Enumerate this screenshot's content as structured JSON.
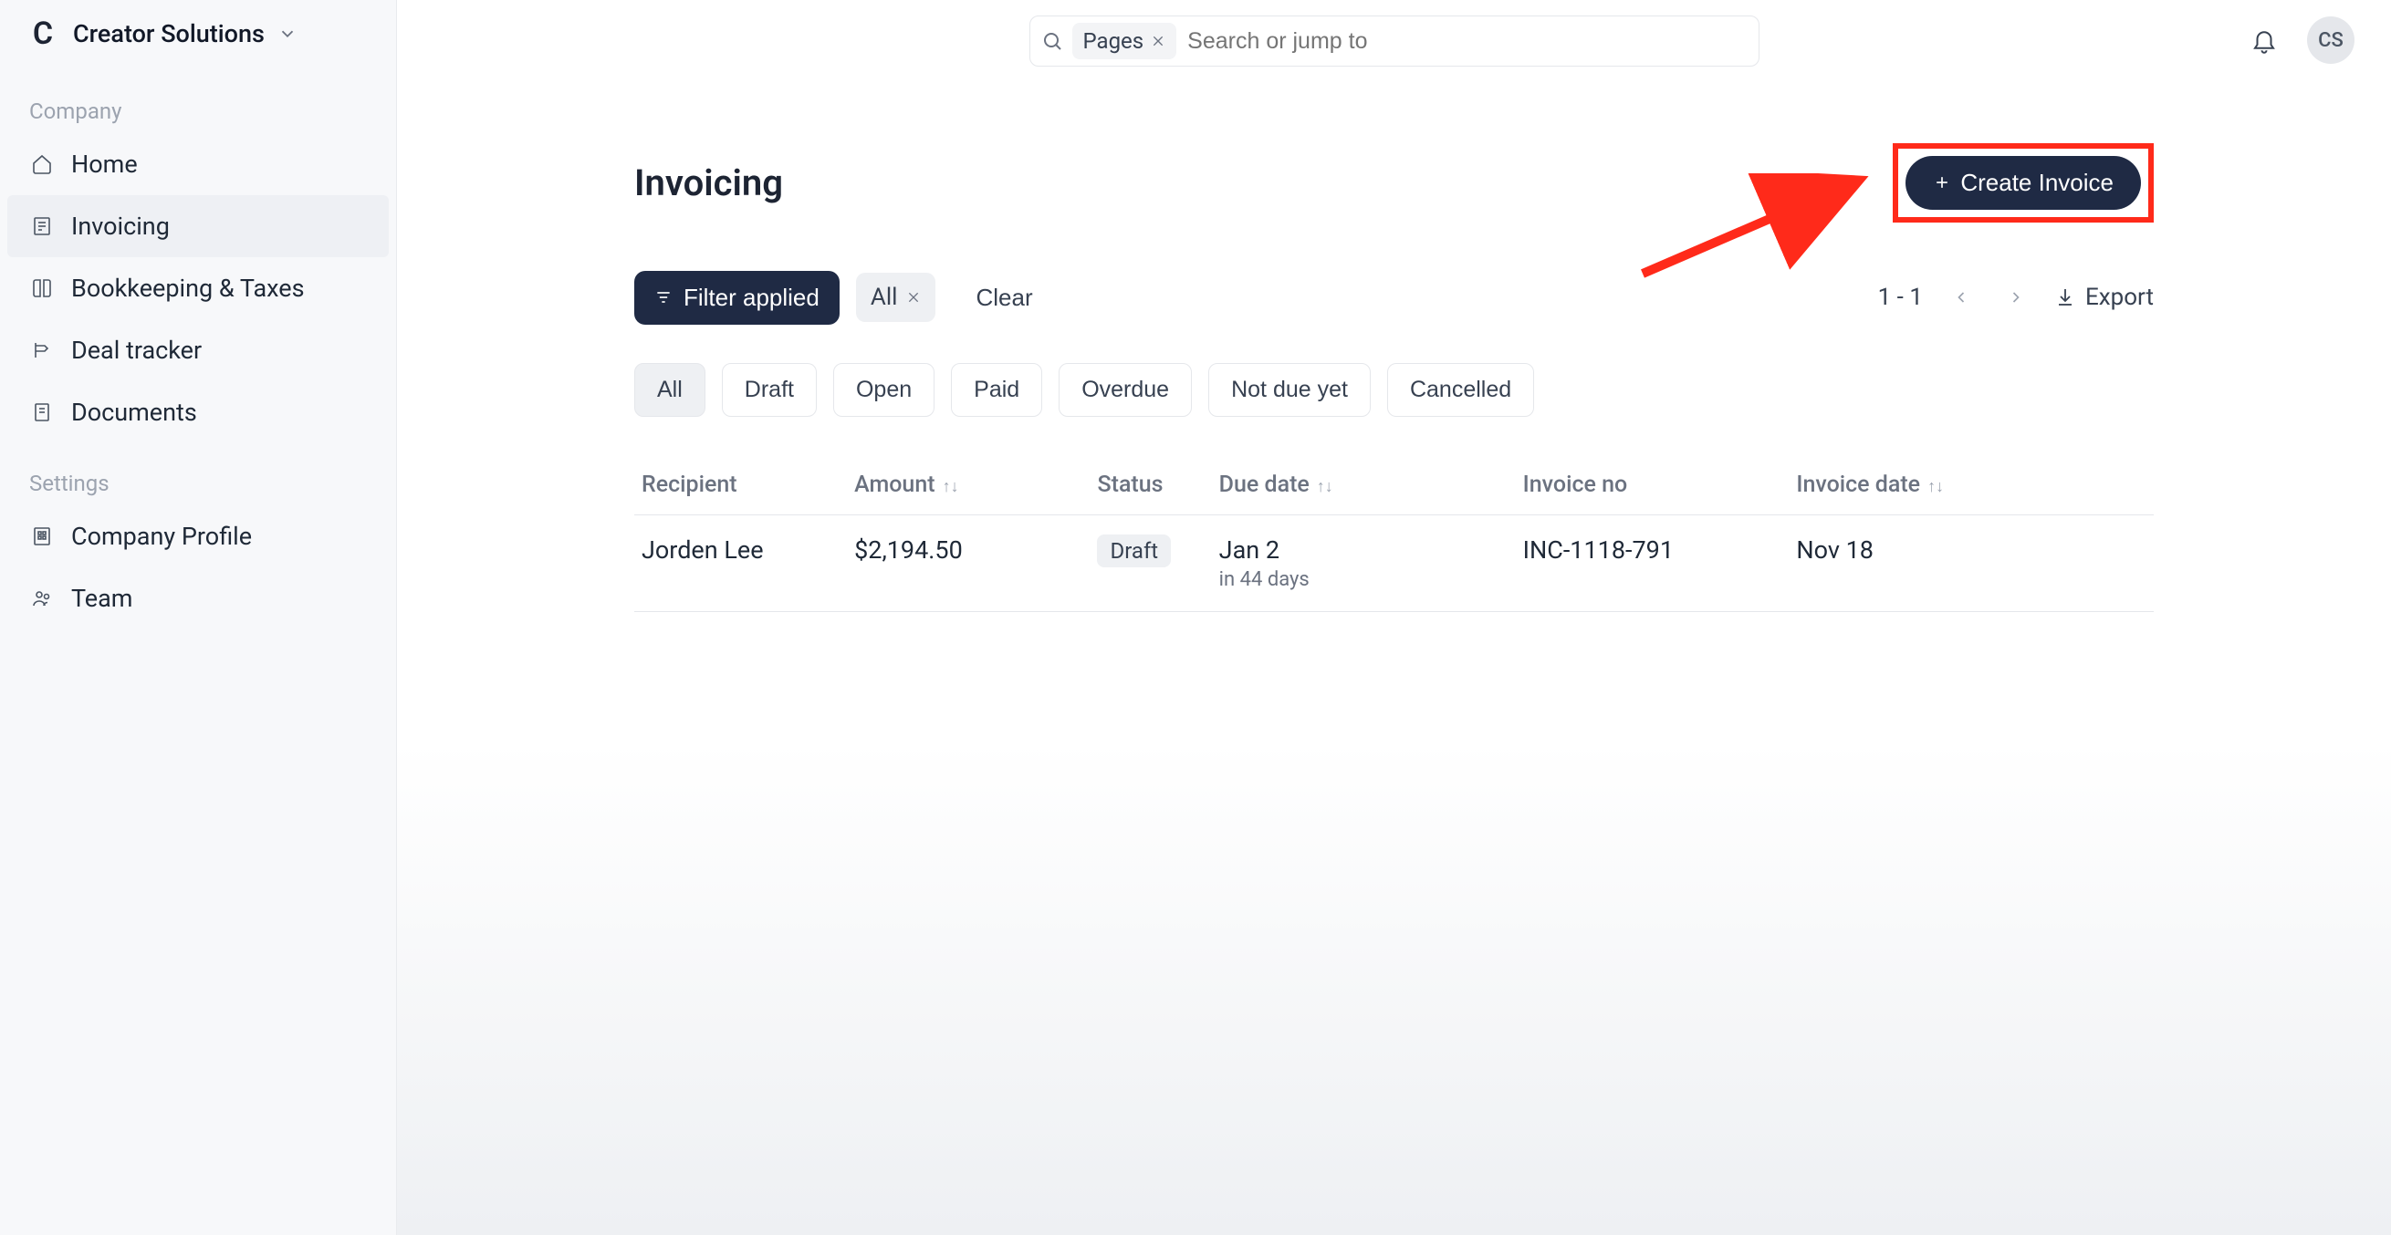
{
  "org": {
    "name": "Creator Solutions",
    "logo_letter": "C"
  },
  "sidebar": {
    "section1_label": "Company",
    "section2_label": "Settings",
    "items": [
      {
        "label": "Home",
        "icon": "home-icon"
      },
      {
        "label": "Invoicing",
        "icon": "invoice-icon"
      },
      {
        "label": "Bookkeeping & Taxes",
        "icon": "book-icon"
      },
      {
        "label": "Deal tracker",
        "icon": "deal-icon"
      },
      {
        "label": "Documents",
        "icon": "documents-icon"
      }
    ],
    "settings_items": [
      {
        "label": "Company Profile",
        "icon": "company-icon"
      },
      {
        "label": "Team",
        "icon": "team-icon"
      }
    ]
  },
  "search": {
    "chip_label": "Pages",
    "placeholder": "Search or jump to"
  },
  "user": {
    "initials": "CS"
  },
  "page": {
    "title": "Invoicing",
    "create_label": "Create Invoice",
    "filter_applied_label": "Filter applied",
    "all_chip_label": "All",
    "clear_label": "Clear",
    "pagination": "1 - 1",
    "export_label": "Export"
  },
  "status_tabs": [
    "All",
    "Draft",
    "Open",
    "Paid",
    "Overdue",
    "Not due yet",
    "Cancelled"
  ],
  "table": {
    "headers": {
      "recipient": "Recipient",
      "amount": "Amount",
      "status": "Status",
      "due_date": "Due date",
      "invoice_no": "Invoice no",
      "invoice_date": "Invoice date"
    },
    "rows": [
      {
        "recipient": "Jorden Lee",
        "amount": "$2,194.50",
        "status": "Draft",
        "due_date": "Jan 2",
        "due_sub": "in 44 days",
        "invoice_no": "INC-1118-791",
        "invoice_date": "Nov 18"
      }
    ]
  }
}
